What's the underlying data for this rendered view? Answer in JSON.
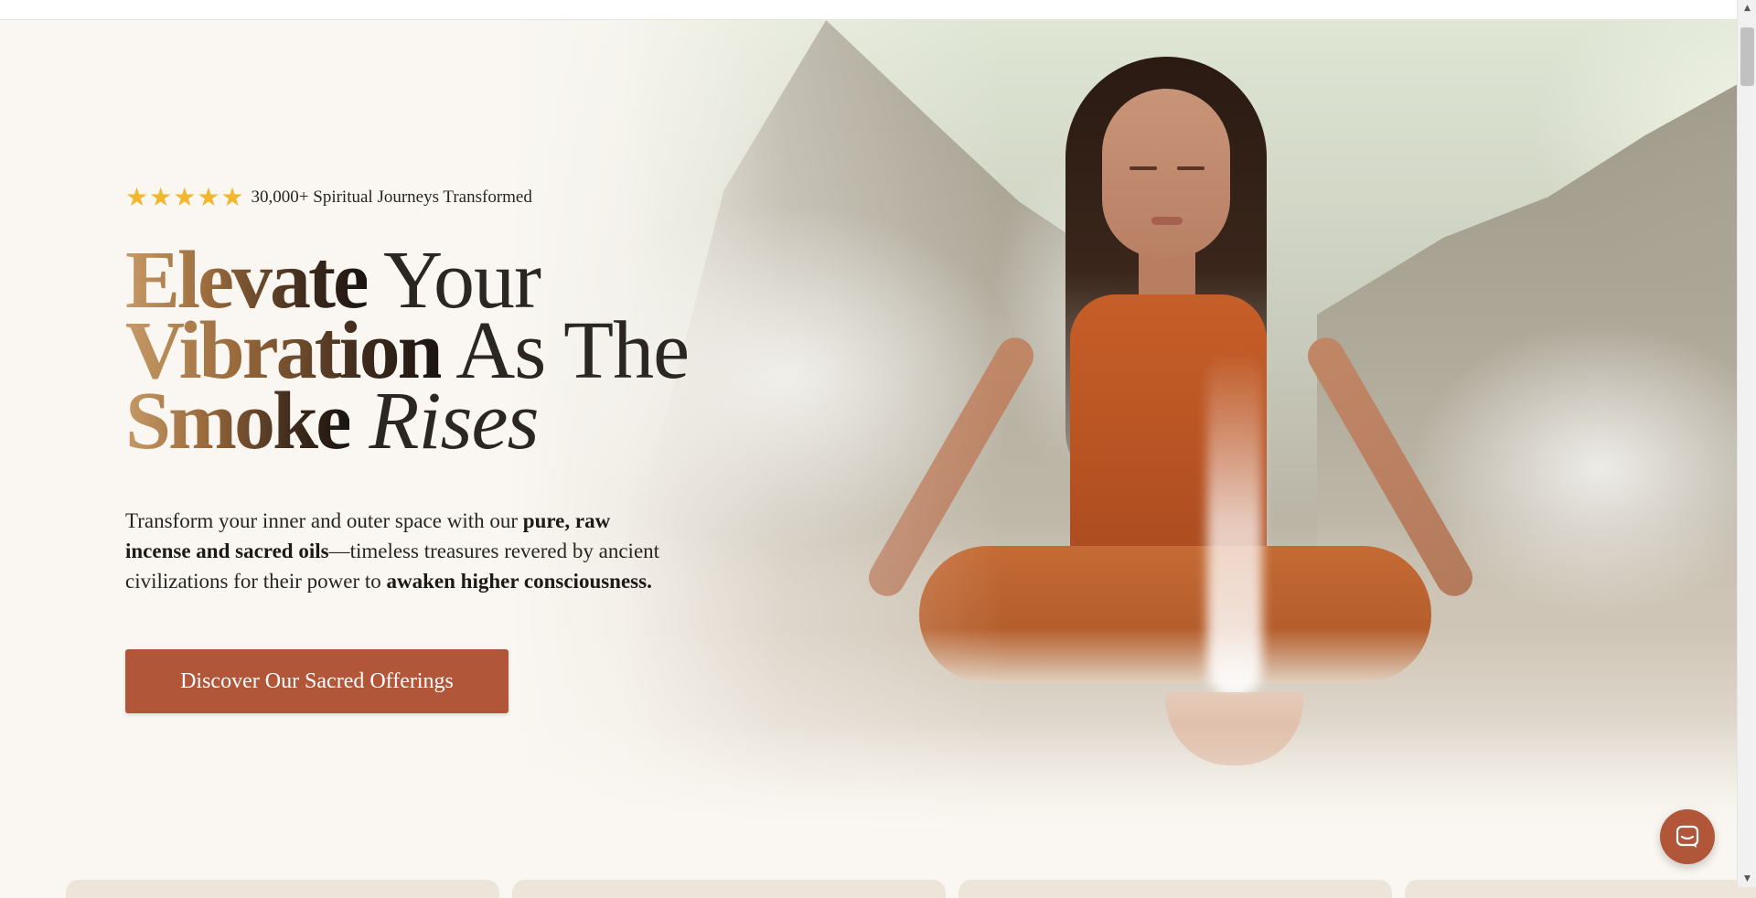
{
  "hero": {
    "rating": {
      "stars": [
        "★",
        "★",
        "★",
        "★",
        "★"
      ],
      "star_count": 5,
      "text": "30,000+ Spiritual Journeys Transformed"
    },
    "headline": {
      "line1_gradient": "Elevate",
      "line1_rest": " Your",
      "line2_gradient": "Vibration",
      "line2_rest": " As The",
      "line3_gradient": "Smoke",
      "line3_italic": "Rises"
    },
    "description": {
      "part1": "Transform your inner and outer space with our ",
      "bold1": "pure, raw incense and sacred oils",
      "part2": "—timeless treasures revered by ancient civilizations for their power to ",
      "bold2": "awaken higher consciousness."
    },
    "cta_label": "Discover Our Sacred Offerings"
  },
  "chat": {
    "icon": "chat-bubble-icon"
  },
  "scrollbar": {
    "up_arrow": "▲",
    "down_arrow": "▼"
  },
  "colors": {
    "accent": "#b2563a",
    "star": "#f2b72c",
    "background": "#faf7f2",
    "text": "#2a2420"
  }
}
